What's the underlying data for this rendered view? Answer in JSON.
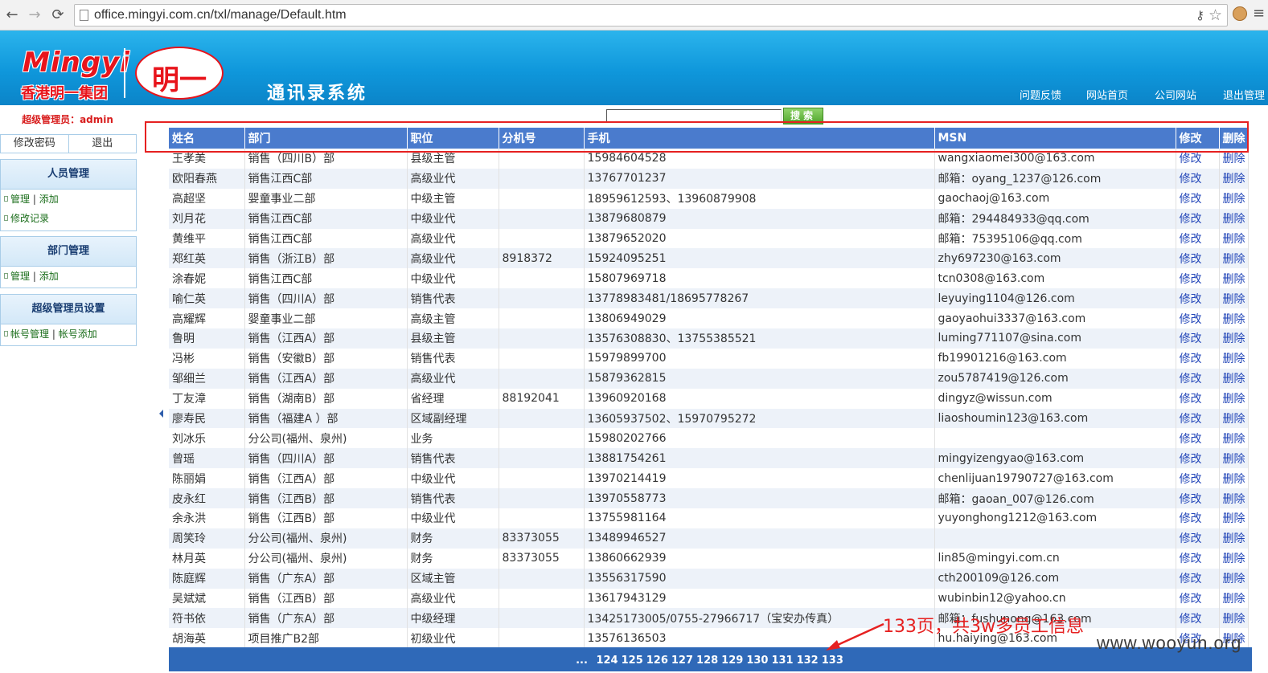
{
  "browser": {
    "url": "office.mingyi.com.cn/txl/manage/Default.htm"
  },
  "header": {
    "logo_en": "Mingyi",
    "logo_cn": "香港明一集团",
    "logo_mark": "明一",
    "system_title": "通讯录系统",
    "links": [
      "问题反馈",
      "网站首页",
      "公司网站",
      "退出管理"
    ]
  },
  "sidebar": {
    "admin_label": "超级管理员：admin",
    "change_password": "修改密码",
    "logout": "退出",
    "sections": [
      {
        "title": "人员管理",
        "links": [
          {
            "items": [
              "管理",
              "添加"
            ]
          },
          {
            "items": [
              "修改记录"
            ]
          }
        ]
      },
      {
        "title": "部门管理",
        "links": [
          {
            "items": [
              "管理",
              "添加"
            ]
          }
        ]
      },
      {
        "title": "超级管理员设置",
        "links": [
          {
            "items": [
              "帐号管理",
              "帐号添加"
            ]
          }
        ]
      }
    ]
  },
  "search": {
    "value": "",
    "button": "搜索"
  },
  "table": {
    "headers": [
      "姓名",
      "部门",
      "职位",
      "分机号",
      "手机",
      "MSN",
      "修改",
      "删除"
    ],
    "rows": [
      [
        "王孝美",
        "销售（四川B）部",
        "县级主管",
        "",
        "15984604528",
        "wangxiaomei300@163.com",
        "修改",
        "删除"
      ],
      [
        "欧阳春燕",
        "销售江西C部",
        "高级业代",
        "",
        "13767701237",
        "邮箱：oyang_1237@126.com",
        "修改",
        "删除"
      ],
      [
        "高超坚",
        "婴童事业二部",
        "中级主管",
        "",
        "18959612593、13960879908",
        "gaochaoj@163.com",
        "修改",
        "删除"
      ],
      [
        "刘月花",
        "销售江西C部",
        "中级业代",
        "",
        "13879680879",
        "邮箱：294484933@qq.com",
        "修改",
        "删除"
      ],
      [
        "黄维平",
        "销售江西C部",
        "高级业代",
        "",
        "13879652020",
        "邮箱：75395106@qq.com",
        "修改",
        "删除"
      ],
      [
        "郑红英",
        "销售（浙江B）部",
        "高级业代",
        "8918372",
        "15924095251",
        "zhy697230@163.com",
        "修改",
        "删除"
      ],
      [
        "涂春妮",
        "销售江西C部",
        "中级业代",
        "",
        "15807969718",
        "tcn0308@163.com",
        "修改",
        "删除"
      ],
      [
        "喻仁英",
        "销售（四川A）部",
        "销售代表",
        "",
        "13778983481/18695778267",
        "leyuying1104@126.com",
        "修改",
        "删除"
      ],
      [
        "高耀辉",
        "婴童事业二部",
        "高级主管",
        "",
        "13806949029",
        "gaoyaohui3337@163.com",
        "修改",
        "删除"
      ],
      [
        "鲁明",
        "销售（江西A）部",
        "县级主管",
        "",
        "13576308830、13755385521",
        "luming771107@sina.com",
        "修改",
        "删除"
      ],
      [
        "冯彬",
        "销售（安徽B）部",
        "销售代表",
        "",
        "15979899700",
        "fb19901216@163.com",
        "修改",
        "删除"
      ],
      [
        "邹细兰",
        "销售（江西A）部",
        "高级业代",
        "",
        "15879362815",
        "zou5787419@126.com",
        "修改",
        "删除"
      ],
      [
        "丁友漳",
        "销售（湖南B）部",
        "省经理",
        "88192041",
        "13960920168",
        "dingyz@wissun.com",
        "修改",
        "删除"
      ],
      [
        "廖寿民",
        "销售（福建A ）部",
        "区域副经理",
        "",
        "13605937502、15970795272",
        "liaoshoumin123@163.com",
        "修改",
        "删除"
      ],
      [
        "刘冰乐",
        "分公司(福州、泉州)",
        "业务",
        "",
        "15980202766",
        "",
        "修改",
        "删除"
      ],
      [
        "曾瑶",
        "销售（四川A）部",
        "销售代表",
        "",
        "13881754261",
        "mingyizengyao@163.com",
        "修改",
        "删除"
      ],
      [
        "陈丽娟",
        "销售（江西A）部",
        "中级业代",
        "",
        "13970214419",
        "chenlijuan19790727@163.com",
        "修改",
        "删除"
      ],
      [
        "皮永红",
        "销售（江西B）部",
        "销售代表",
        "",
        "13970558773",
        "邮箱：gaoan_007@126.com",
        "修改",
        "删除"
      ],
      [
        "余永洪",
        "销售（江西B）部",
        "中级业代",
        "",
        "13755981164",
        "yuyonghong1212@163.com",
        "修改",
        "删除"
      ],
      [
        "周笑玲",
        "分公司(福州、泉州)",
        "财务",
        "83373055",
        "13489946527",
        "",
        "修改",
        "删除"
      ],
      [
        "林月英",
        "分公司(福州、泉州)",
        "财务",
        "83373055",
        "13860662939",
        "lin85@mingyi.com.cn",
        "修改",
        "删除"
      ],
      [
        "陈庭辉",
        "销售（广东A）部",
        "区域主管",
        "",
        "13556317590",
        "cth200109@126.com",
        "修改",
        "删除"
      ],
      [
        "吴斌斌",
        "销售（江西B）部",
        "高级业代",
        "",
        "13617943129",
        "wubinbin12@yahoo.cn",
        "修改",
        "删除"
      ],
      [
        "符书依",
        "销售（广东A）部",
        "中级经理",
        "",
        "13425173005/0755-27966717（宝安办传真）",
        "邮箱：fushunong@163.com",
        "修改",
        "删除"
      ],
      [
        "胡海英",
        "项目推广B2部",
        "初级业代",
        "",
        "13576136503",
        "hu.haiying@163.com",
        "修改",
        "删除"
      ]
    ]
  },
  "pager": {
    "ellipsis": "...",
    "pages": [
      "124",
      "125",
      "126",
      "127",
      "128",
      "129",
      "130",
      "131",
      "132",
      "133"
    ]
  },
  "annotation": "133页，共3w多员工信息",
  "watermark": "www.wooyun.org",
  "colors": {
    "header_blue": "#0f97db",
    "table_header": "#4a7bcd",
    "pager_bg": "#2f69b8",
    "annotation_red": "#e62121",
    "link_blue": "#2145b8"
  }
}
